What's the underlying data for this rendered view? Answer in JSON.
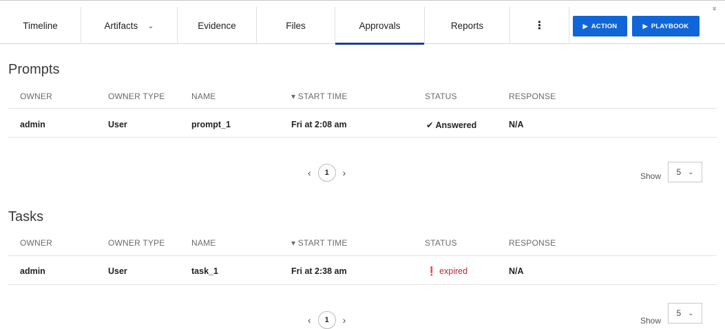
{
  "tabs": {
    "timeline": "Timeline",
    "artifacts": "Artifacts",
    "evidence": "Evidence",
    "files": "Files",
    "approvals": "Approvals",
    "reports": "Reports",
    "more": "⋮",
    "active": "Approvals"
  },
  "actions": {
    "action_label": "ACTION",
    "playbook_label": "PLAYBOOK",
    "play_icon": "▶",
    "collapse_icon": "»"
  },
  "colors": {
    "accent_blue": "#1066d8",
    "active_tab_underline": "#1a3f8f",
    "expired_red": "#c0262d"
  },
  "columns": {
    "owner": "OWNER",
    "owner_type": "OWNER TYPE",
    "name": "NAME",
    "start_time": "▾ START TIME",
    "status": "STATUS",
    "response": "RESPONSE"
  },
  "prompts": {
    "title": "Prompts",
    "rows": [
      {
        "owner": "admin",
        "owner_type": "User",
        "name": "prompt_1",
        "start_time": "Fri at 2:08 am",
        "status_icon": "✔",
        "status": "Answered",
        "response": "N/A"
      }
    ],
    "pager": {
      "prev": "‹",
      "page": "1",
      "next": "›"
    },
    "show_label": "Show",
    "show_value": "5"
  },
  "tasks": {
    "title": "Tasks",
    "rows": [
      {
        "owner": "admin",
        "owner_type": "User",
        "name": "task_1",
        "start_time": "Fri at 2:38 am",
        "status_icon": "❗",
        "status": "expired",
        "response": "N/A"
      }
    ],
    "pager": {
      "prev": "‹",
      "page": "1",
      "next": "›"
    },
    "show_label": "Show",
    "show_value": "5"
  }
}
